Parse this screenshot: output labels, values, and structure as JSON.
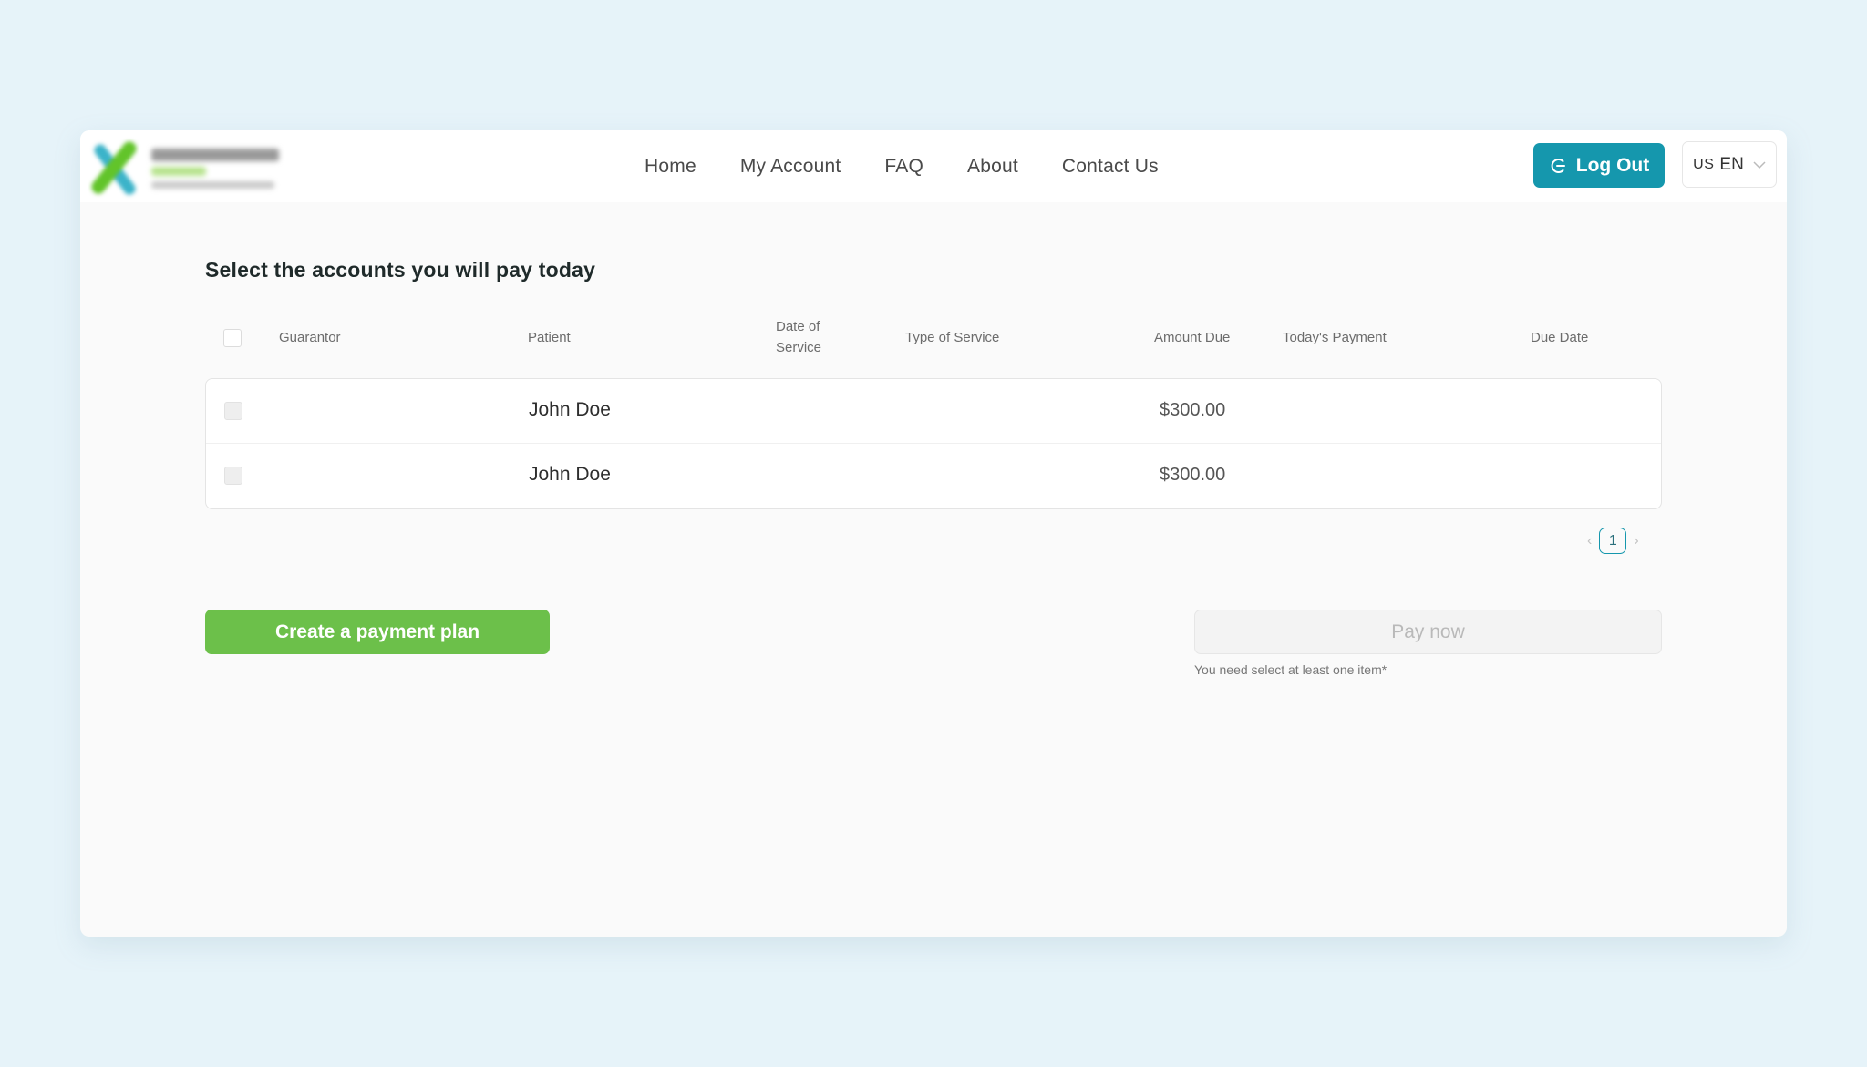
{
  "header": {
    "logo_alt": "Company logo",
    "nav": [
      "Home",
      "My Account",
      "FAQ",
      "About",
      "Contact Us"
    ],
    "logout_label": "Log Out",
    "language": {
      "flag_code": "US",
      "lang": "EN"
    }
  },
  "main": {
    "title": "Select the accounts you will pay today",
    "columns": {
      "guarantor": "Guarantor",
      "patient": "Patient",
      "date_of_service_1": "Date of",
      "date_of_service_2": "Service",
      "type_of_service": "Type of Service",
      "amount_due": "Amount Due",
      "todays_payment": "Today's Payment",
      "due_date": "Due Date"
    },
    "rows": [
      {
        "guarantor": "",
        "patient": "John Doe",
        "date_of_service": "",
        "type_of_service": "",
        "amount_due": "$300.00",
        "todays_payment": "",
        "due_date": "",
        "checked": false
      },
      {
        "guarantor": "",
        "patient": "John Doe",
        "date_of_service": "",
        "type_of_service": "",
        "amount_due": "$300.00",
        "todays_payment": "",
        "due_date": "",
        "checked": false
      }
    ],
    "pagination": {
      "prev": "‹",
      "current": "1",
      "next": "›"
    },
    "create_plan_label": "Create a payment plan",
    "pay_now_label": "Pay now",
    "pay_hint": "You need select at least one item*"
  },
  "colors": {
    "background": "#e6f3f9",
    "primary_teal": "#1597ad",
    "accent_green": "#6cc04a"
  }
}
